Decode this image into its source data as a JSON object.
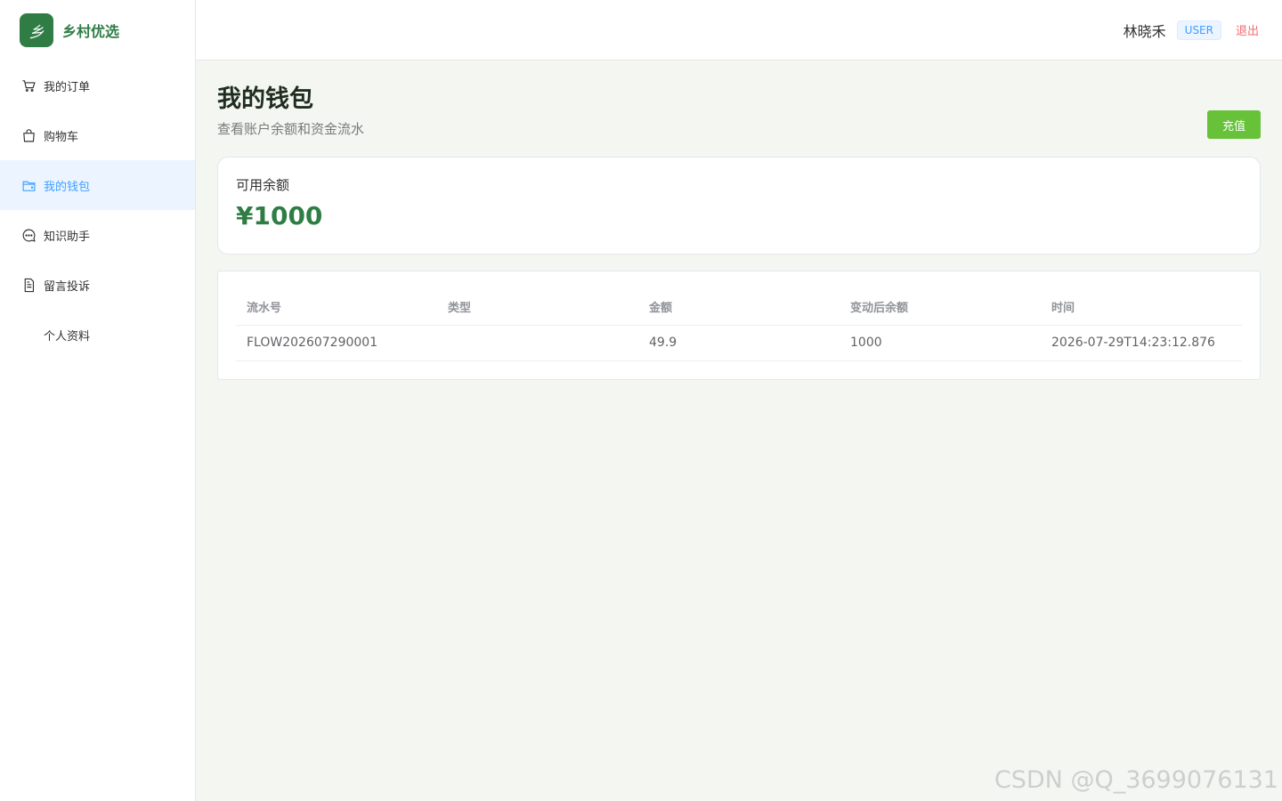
{
  "brand": {
    "logo_text": "乡",
    "name": "乡村优选"
  },
  "sidebar": {
    "items": [
      {
        "label": "我的订单",
        "icon": "cart-icon",
        "active": false
      },
      {
        "label": "购物车",
        "icon": "bag-icon",
        "active": false
      },
      {
        "label": "我的钱包",
        "icon": "wallet-icon",
        "active": true
      },
      {
        "label": "知识助手",
        "icon": "chat-icon",
        "active": false
      },
      {
        "label": "留言投诉",
        "icon": "document-icon",
        "active": false
      },
      {
        "label": "个人资料",
        "icon": "",
        "active": false
      }
    ]
  },
  "header": {
    "username": "林晓禾",
    "role": "USER",
    "logout": "退出"
  },
  "page": {
    "title": "我的钱包",
    "subtitle": "查看账户余额和资金流水",
    "recharge_label": "充值"
  },
  "balance": {
    "label": "可用余额",
    "value": "¥1000"
  },
  "table": {
    "columns": [
      "流水号",
      "类型",
      "金额",
      "变动后余额",
      "时间"
    ],
    "rows": [
      [
        "FLOW202607290001",
        "",
        "49.9",
        "1000",
        "2026-07-29T14:23:12.876"
      ]
    ]
  },
  "watermark": "CSDN @Q_3699076131",
  "colors": {
    "primary_green": "#2f7d45",
    "accent_blue": "#409eff",
    "success": "#67c23a",
    "danger": "#f56c6c"
  }
}
